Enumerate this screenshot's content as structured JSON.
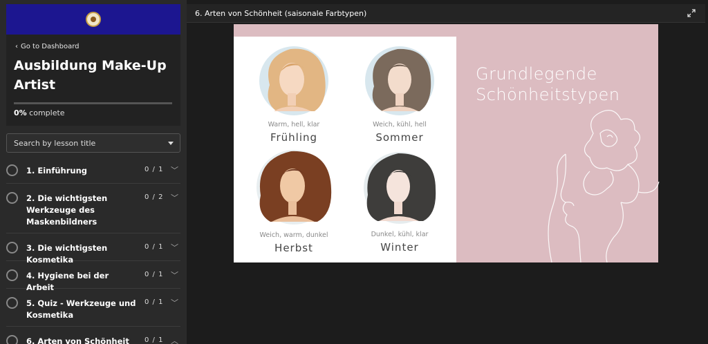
{
  "sidebar": {
    "back_label": "Go to Dashboard",
    "course_title": "Ausbildung Make-Up Artist",
    "progress": {
      "percent_label": "0%",
      "suffix": " complete",
      "value": 0
    },
    "search_placeholder": "Search by lesson title",
    "lessons": [
      {
        "title": "1. Einführung",
        "count": "0 / 1",
        "expanded": false
      },
      {
        "title": "2. Die wichtigsten Werkzeuge des Maskenbildners",
        "count": "0 / 2",
        "expanded": false
      },
      {
        "title": "3. Die wichtigsten Kosmetika",
        "count": "0 / 1",
        "expanded": false
      },
      {
        "title": "4. Hygiene bei der Arbeit",
        "count": "0 / 1",
        "expanded": false
      },
      {
        "title": "5. Quiz - Werkzeuge und Kosmetika",
        "count": "0 / 1",
        "expanded": false
      },
      {
        "title": "6. Arten von Schönheit",
        "count": "0 / 1",
        "expanded": true
      }
    ]
  },
  "main": {
    "lesson_title": "6. Arten von Schönheit (saisonale Farbtypen)",
    "slide": {
      "heading": [
        "Grundlegende",
        "Schönheitstypen"
      ],
      "types": [
        {
          "subtitle": "Warm, hell, klar",
          "name": "Frühling"
        },
        {
          "subtitle": "Weich, kühl, hell",
          "name": "Sommer"
        },
        {
          "subtitle": "Weich, warm, dunkel",
          "name": "Herbst"
        },
        {
          "subtitle": "Dunkel, kühl, klar",
          "name": "Winter"
        }
      ]
    }
  },
  "colors": {
    "banner": "#1c1690",
    "slide_bg": "#dcbcc1"
  }
}
